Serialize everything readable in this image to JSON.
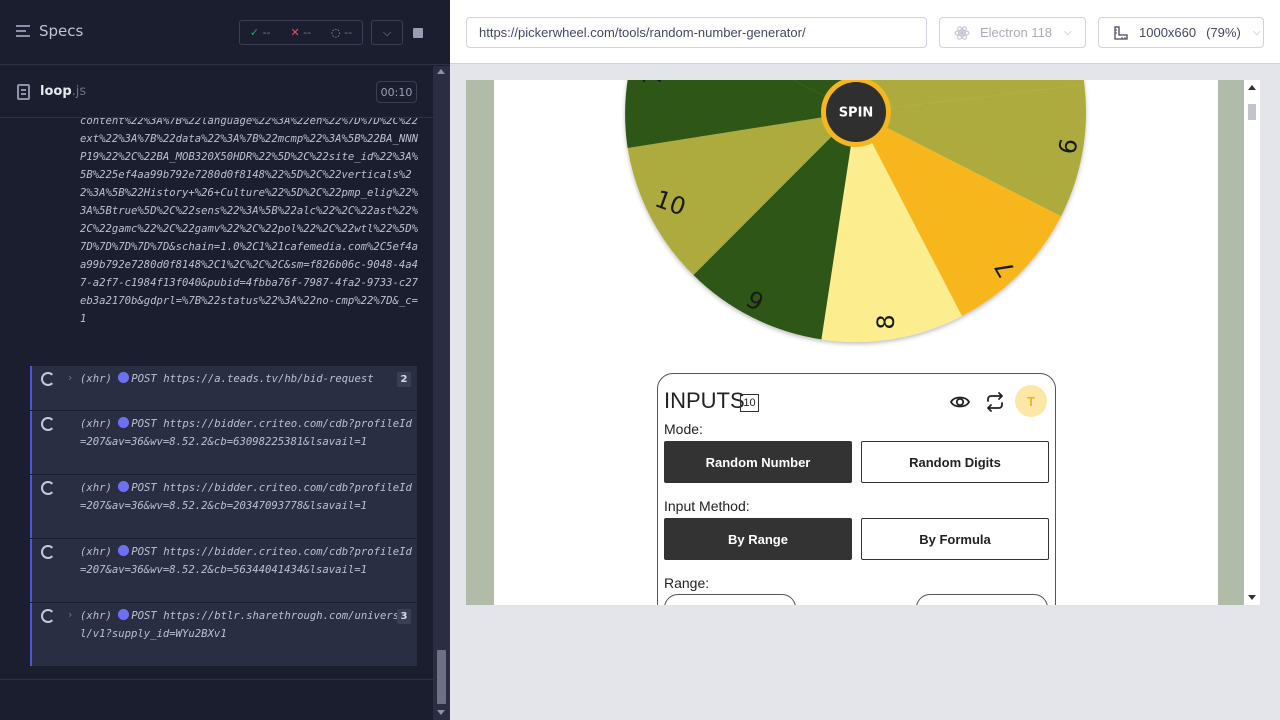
{
  "reporter": {
    "specs_label": "Specs",
    "stats": {
      "passed": "--",
      "failed": "--",
      "pending": "--"
    },
    "spec_file": {
      "name": "loop",
      "ext": ".js"
    },
    "timer": "00:10",
    "prev_log_text": "content%22%3A%7B%22language%22%3A%22en%22%7D%7D%2C%22ext%22%3A%7B%22data%22%3A%7B%22mcmp%22%3A%5B%22BA_NNNP19%22%2C%22BA_MOB320X50HDR%22%5D%2C%22site_id%22%3A%5B%225ef4aa99b792e7280d0f8148%22%5D%2C%22verticals%22%3A%5B%22History+%26+Culture%22%5D%2C%22pmp_elig%22%3A%5Btrue%5D%2C%22sens%22%3A%5B%22alc%22%2C%22ast%22%2C%22gamc%22%2C%22gamv%22%2C%22pol%22%2C%22wtl%22%5D%7D%7D%7D%7D%7D&schain=1.0%2C1%21cafemedia.com%2C5ef4aa99b792e7280d0f8148%2C1%2C%2C%2C&sm=f826b06c-9048-4a47-a2f7-c1984f13f040&pubid=4fbba76f-7987-4fa2-9733-c27eb3a2170b&gdprl=%7B%22status%22%3A%22no-cmp%22%7D&_c=1",
    "xhr_entries": [
      {
        "type": "(xhr)",
        "method": "POST",
        "url": "https://a.teads.tv/hb/bid-request",
        "count": "2",
        "expandable": true
      },
      {
        "type": "(xhr)",
        "method": "POST",
        "url": "https://bidder.criteo.com/cdb?profileId=207&av=36&wv=8.52.2&cb=63098225381&lsavail=1",
        "count": "",
        "expandable": false
      },
      {
        "type": "(xhr)",
        "method": "POST",
        "url": "https://bidder.criteo.com/cdb?profileId=207&av=36&wv=8.52.2&cb=20347093778&lsavail=1",
        "count": "",
        "expandable": false
      },
      {
        "type": "(xhr)",
        "method": "POST",
        "url": "https://bidder.criteo.com/cdb?profileId=207&av=36&wv=8.52.2&cb=56344041434&lsavail=1",
        "count": "",
        "expandable": false
      },
      {
        "type": "(xhr)",
        "method": "POST",
        "url": "https://btlr.sharethrough.com/universal/v1?supply_id=WYu2BXv1",
        "count": "3",
        "expandable": true
      }
    ]
  },
  "aut": {
    "url": "https://pickerwheel.com/tools/random-number-generator/",
    "browser": "Electron 118",
    "viewport": "1000x660",
    "zoom": "(79%)"
  },
  "wheel": {
    "spin_label": "SPIN",
    "visible_numbers": [
      "7",
      "9",
      "10",
      "7",
      "6",
      "8"
    ],
    "colors": {
      "dark_green": "#2e5712",
      "olive": "#adab3c",
      "yellow": "#f6b61f",
      "pale": "#fcee8f",
      "spin_ring": "#f6b61f",
      "spin_center": "#2f2f2f"
    }
  },
  "inputs": {
    "title": "INPUTS",
    "badge": "10",
    "avatar_letter": "T",
    "mode_label": "Mode:",
    "mode_options": [
      "Random Number",
      "Random Digits"
    ],
    "mode_selected": "Random Number",
    "method_label": "Input Method:",
    "method_options": [
      "By Range",
      "By Formula"
    ],
    "method_selected": "By Range",
    "range_label": "Range:"
  }
}
